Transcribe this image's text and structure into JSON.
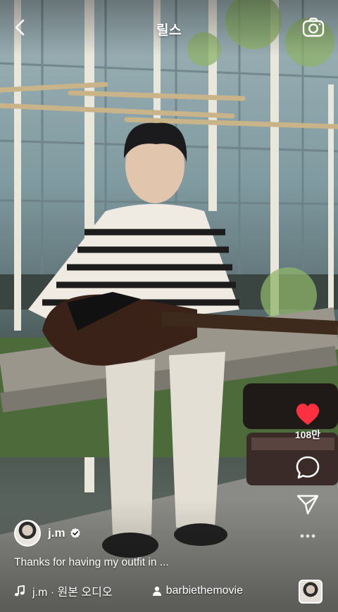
{
  "header": {
    "title": "릴스",
    "back_icon": "chevron-left-icon",
    "camera_icon": "camera-icon"
  },
  "actions": {
    "like_count": "108만",
    "like_color": "#ff3040",
    "like_icon": "heart-icon",
    "comment_icon": "comment-icon",
    "share_icon": "send-icon",
    "more_icon": "more-horizontal-icon"
  },
  "post": {
    "username": "j.m",
    "verified": true,
    "caption": "Thanks for having my outfit in ...",
    "audio": "j.m · 원본 오디오",
    "tagged_user": "barbiethemovie"
  }
}
